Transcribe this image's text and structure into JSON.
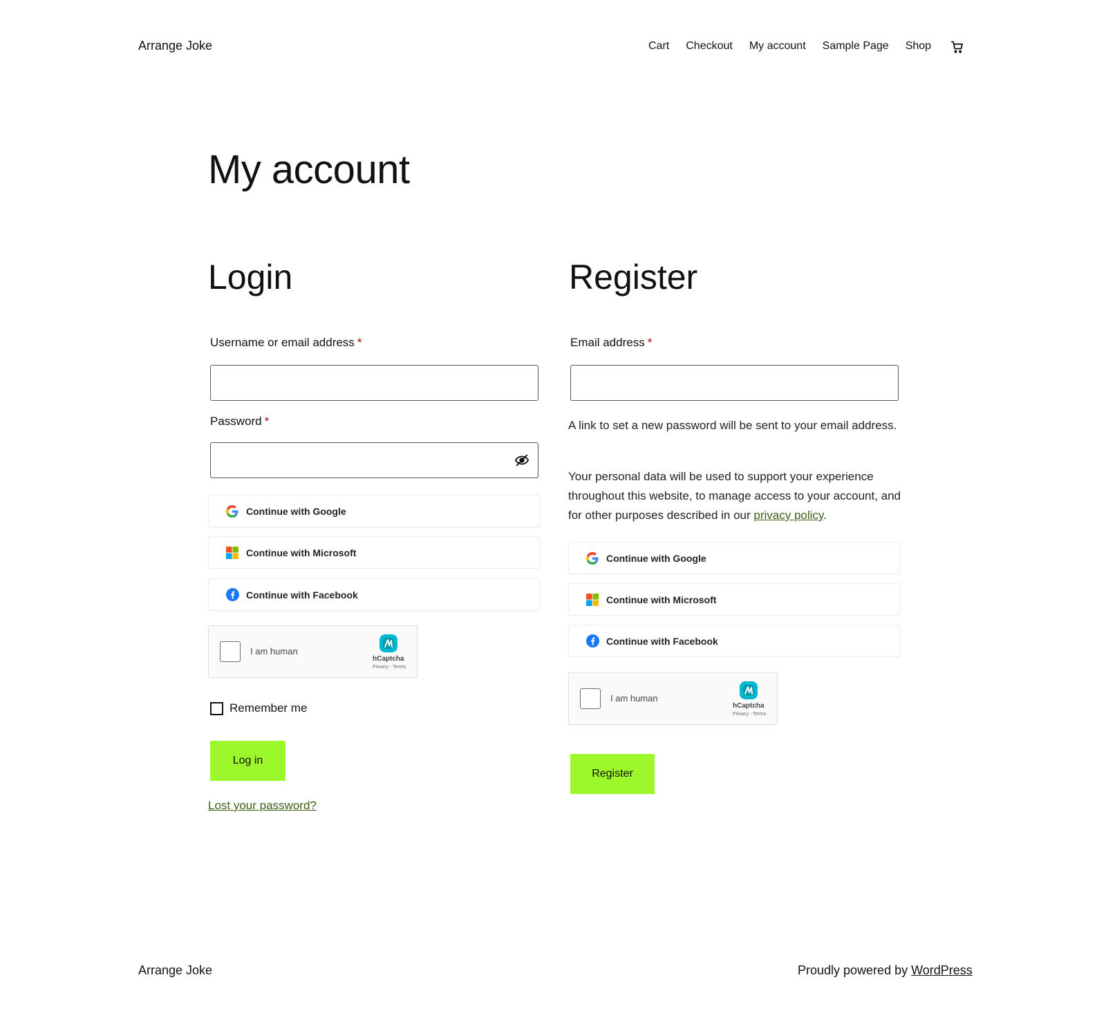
{
  "header": {
    "site_title": "Arrange Joke",
    "nav": [
      "Cart",
      "Checkout",
      "My account",
      "Sample Page",
      "Shop"
    ]
  },
  "page": {
    "title": "My account"
  },
  "login": {
    "title": "Login",
    "username_label": "Username or email address",
    "password_label": "Password",
    "required_mark": "*",
    "social": {
      "google": "Continue with Google",
      "microsoft": "Continue with Microsoft",
      "facebook": "Continue with Facebook"
    },
    "captcha": {
      "text": "I am human",
      "brand": "hCaptcha",
      "terms": "Privacy - Terms"
    },
    "remember_label": "Remember me",
    "login_button": "Log in",
    "lost_password": "Lost your password?"
  },
  "register": {
    "title": "Register",
    "email_label": "Email address",
    "required_mark": "*",
    "info_text": "A link to set a new password will be sent to your email address.",
    "privacy_text_before": "Your personal data will be used to support your experience throughout this website, to manage access to your account, and for other purposes described in our ",
    "privacy_link": "privacy policy",
    "privacy_text_after": ".",
    "social": {
      "google": "Continue with Google",
      "microsoft": "Continue with Microsoft",
      "facebook": "Continue with Facebook"
    },
    "captcha": {
      "text": "I am human",
      "brand": "hCaptcha",
      "terms": "Privacy - Terms"
    },
    "register_button": "Register"
  },
  "footer": {
    "site_title": "Arrange Joke",
    "powered_prefix": "Proudly powered by ",
    "powered_link": "WordPress"
  },
  "colors": {
    "button_green": "#9cf82a",
    "link_green": "#3e5e1a",
    "required_red": "#b00000"
  },
  "icons": {
    "cart": "cart-icon",
    "eye": "eye-slash-icon",
    "google": "google-icon",
    "microsoft": "microsoft-icon",
    "facebook": "facebook-icon",
    "hcaptcha": "hcaptcha-logo-icon"
  }
}
